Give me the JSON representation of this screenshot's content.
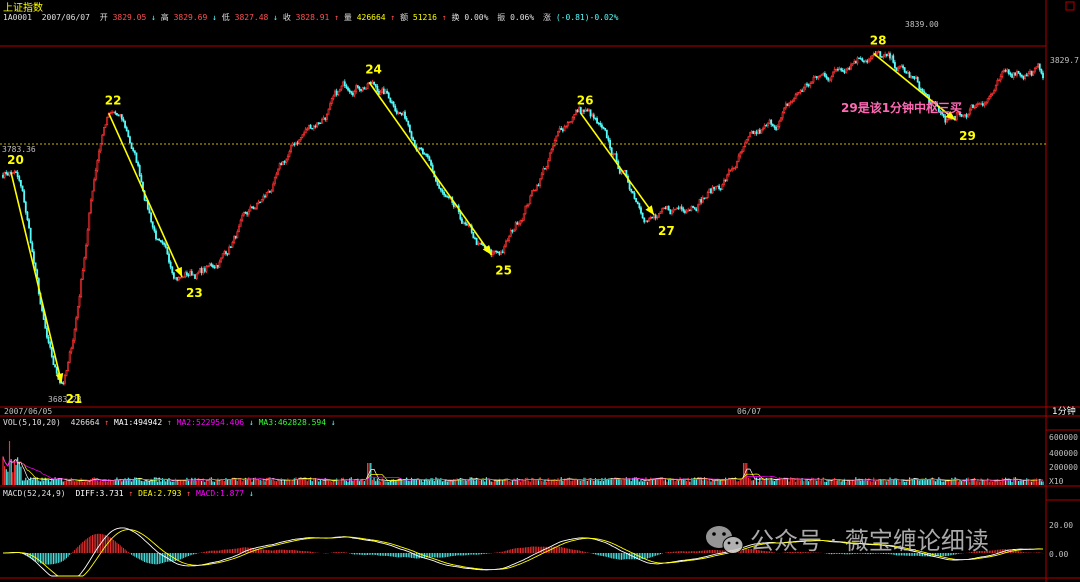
{
  "header": {
    "title": "上证指数",
    "info_code": "1A0001",
    "info_date": "2007/06/07",
    "open_label": "开",
    "open": "3829.05",
    "high_label": "高",
    "high": "3829.69",
    "low_label": "低",
    "low": "3827.48",
    "close_label": "收",
    "close": "3828.91",
    "volume_label": "量",
    "volume": "426664",
    "amount_label": "额",
    "amount": "51216",
    "turnover_label": "换",
    "turnover": "0.00%",
    "amplitude_label": "振",
    "amplitude": "0.06%",
    "change_label": "涨",
    "change": "(-0.81)-0.02%"
  },
  "price_axis": {
    "left_ref": "3783.36",
    "right_last": "3829.7",
    "high_marker": "3839.00",
    "low_marker": "3683.23"
  },
  "time_axis": {
    "start_label": "2007/06/05",
    "mid_label": "06/07",
    "period": "1分钟"
  },
  "volume_panel": {
    "header_name": "VOL(5,10,20)",
    "header_value": "426664",
    "ma1": "MA1:494942",
    "ma2": "MA2:522954.406",
    "ma3": "MA3:462828.594",
    "ticks": [
      "600000",
      "400000",
      "200000"
    ],
    "unit": "X10"
  },
  "macd_panel": {
    "header_name": "MACD(52,24,9)",
    "diff": "DIFF:3.731",
    "dea": "DEA:2.793",
    "macd": "MACD:1.877",
    "ticks": [
      "20.00",
      "0.00"
    ]
  },
  "annotation": "29是该1分钟中枢三买",
  "watermark": "公众号 · 薇宝缠论细读",
  "colors": {
    "up": "#ff3232",
    "down": "#54fcfc",
    "arrow": "#ffff00",
    "label": "#ffff00",
    "annotation": "#ff69b4",
    "axis": "#b00000",
    "ref_line": "#c8b400",
    "ma1": "#ffffff",
    "ma2": "#ffff00",
    "ma3": "#ff00ff",
    "diff": "#ffffff",
    "dea": "#ffff00"
  },
  "chart_data": {
    "type": "candlestick",
    "ylim": [
      3680,
      3842
    ],
    "pivots": [
      {
        "label": "20",
        "t": 5,
        "price": 3785
      },
      {
        "label": "21",
        "t": 36,
        "price": 3690
      },
      {
        "label": "22",
        "t": 65,
        "price": 3812
      },
      {
        "label": "23",
        "t": 110,
        "price": 3738
      },
      {
        "label": "24",
        "t": 225,
        "price": 3826
      },
      {
        "label": "25",
        "t": 300,
        "price": 3748
      },
      {
        "label": "26",
        "t": 355,
        "price": 3812
      },
      {
        "label": "27",
        "t": 400,
        "price": 3766
      },
      {
        "label": "28",
        "t": 535,
        "price": 3839
      },
      {
        "label": "29",
        "t": 585,
        "price": 3809
      },
      {
        "label": "",
        "t": 623,
        "price": 3831
      },
      {
        "label": "",
        "t": 630,
        "price": 3830
      }
    ],
    "arrows": [
      {
        "from": "20",
        "to": "21"
      },
      {
        "from": "22",
        "to": "23"
      },
      {
        "from": "24",
        "to": "25"
      },
      {
        "from": "26",
        "to": "27"
      },
      {
        "from": "28",
        "to": "29"
      }
    ]
  }
}
